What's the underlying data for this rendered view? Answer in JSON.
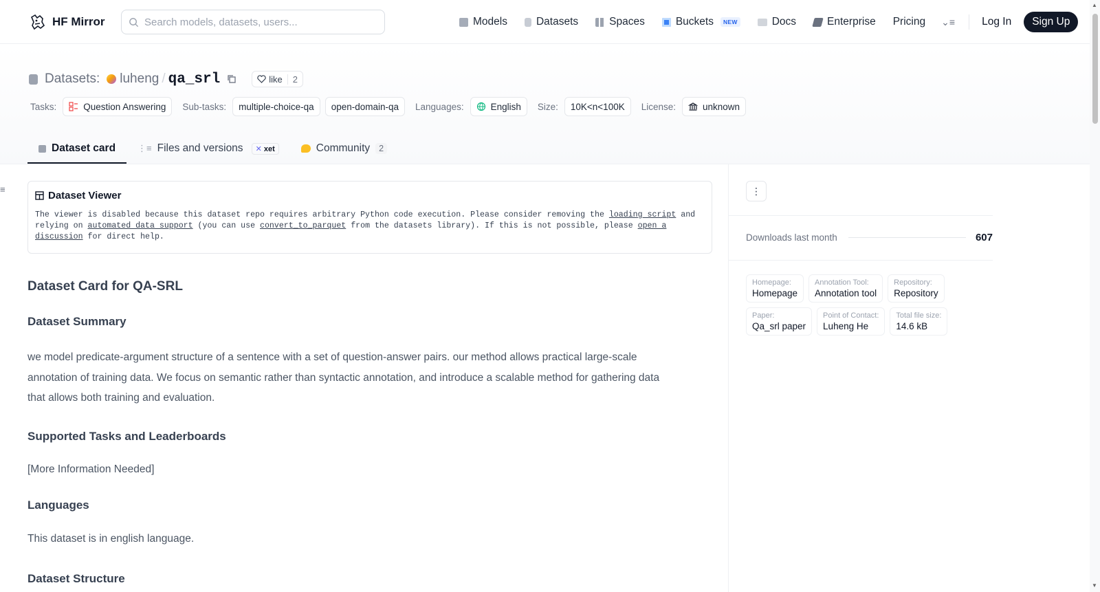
{
  "nav": {
    "brand": "HF Mirror",
    "search_placeholder": "Search models, datasets, users...",
    "links": [
      {
        "label": "Models",
        "icon": "cube-icon"
      },
      {
        "label": "Datasets",
        "icon": "database-icon"
      },
      {
        "label": "Spaces",
        "icon": "grid-icon"
      },
      {
        "label": "Buckets",
        "icon": "bucket-icon",
        "badge": "NEW"
      },
      {
        "label": "Docs",
        "icon": "book-icon"
      },
      {
        "label": "Enterprise",
        "icon": "enterprise-icon"
      },
      {
        "label": "Pricing"
      }
    ],
    "login": "Log In",
    "signup": "Sign Up"
  },
  "repo": {
    "prefix": "Datasets:",
    "owner": "luheng",
    "name": "qa_srl",
    "like_label": "like",
    "like_count": "2"
  },
  "tags": {
    "tasks_label": "Tasks:",
    "task": "Question Answering",
    "subtasks_label": "Sub-tasks:",
    "subtasks": [
      "multiple-choice-qa",
      "open-domain-qa"
    ],
    "languages_label": "Languages:",
    "language": "English",
    "size_label": "Size:",
    "size": "10K<n<100K",
    "license_label": "License:",
    "license": "unknown"
  },
  "tabs": [
    {
      "label": "Dataset card",
      "active": true
    },
    {
      "label": "Files and versions",
      "badge": "xet"
    },
    {
      "label": "Community",
      "count": "2"
    }
  ],
  "viewer": {
    "title": "Dataset Viewer",
    "text1": "The viewer is disabled because this dataset repo requires arbitrary Python code execution. Please consider removing the ",
    "link1": "loading script",
    "text2": " and relying on ",
    "link2": "automated data support",
    "text3": " (you can use ",
    "link3": "convert_to_parquet",
    "text4": " from the datasets library). If this is not possible, please ",
    "link4": "open a discussion",
    "text5": " for direct help."
  },
  "card": {
    "title": "Dataset Card for QA-SRL",
    "summary_heading": "Dataset Summary",
    "summary": "we model predicate-argument structure of a sentence with a set of question-answer pairs. our method allows practical large-scale annotation of training data. We focus on semantic rather than syntactic annotation, and introduce a scalable method for gathering data that allows both training and evaluation.",
    "tasks_heading": "Supported Tasks and Leaderboards",
    "tasks_text": "[More Information Needed]",
    "languages_heading": "Languages",
    "languages_text": "This dataset is in english language.",
    "structure_heading": "Dataset Structure"
  },
  "sidebar": {
    "downloads_label": "Downloads last month",
    "downloads": "607",
    "meta": [
      {
        "key": "Homepage:",
        "value": "Homepage"
      },
      {
        "key": "Annotation Tool:",
        "value": "Annotation tool"
      },
      {
        "key": "Repository:",
        "value": "Repository"
      },
      {
        "key": "Paper:",
        "value": "Qa_srl paper"
      },
      {
        "key": "Point of Contact:",
        "value": "Luheng He"
      },
      {
        "key": "Total file size:",
        "value": "14.6 kB"
      }
    ]
  }
}
